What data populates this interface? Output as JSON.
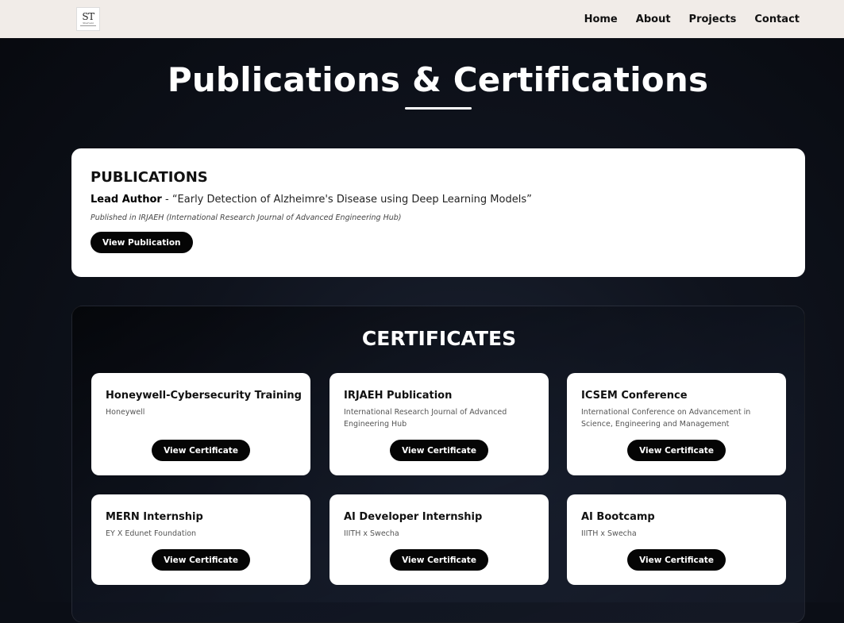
{
  "nav": {
    "logo_text": "ST",
    "logo_sub": "Sharvani",
    "links": [
      "Home",
      "About",
      "Projects",
      "Contact"
    ]
  },
  "page": {
    "title": "Publications & Certifications"
  },
  "publications": {
    "heading": "PUBLICATIONS",
    "role": "Lead Author",
    "separator": " - ",
    "paper_title": "“Early Detection of Alzheimre's Disease using Deep Learning Models”",
    "venue": "Published in IRJAEH (International Research Journal of Advanced Engineering Hub)",
    "button": "View Publication"
  },
  "certificates": {
    "heading": "CERTIFICATES",
    "items": [
      {
        "title": "Honeywell-Cybersecurity Training",
        "issuer": "Honeywell",
        "button": "View Certificate"
      },
      {
        "title": "IRJAEH Publication",
        "issuer": "International Research Journal of Advanced Engineering Hub",
        "button": "View Certificate"
      },
      {
        "title": "ICSEM Conference",
        "issuer": "International Conference on Advancement in Science, Engineering and Management",
        "button": "View Certificate"
      },
      {
        "title": "MERN Internship",
        "issuer": "EY X Edunet Foundation",
        "button": "View Certificate"
      },
      {
        "title": "AI Developer Internship",
        "issuer": "IIITH x Swecha",
        "button": "View Certificate"
      },
      {
        "title": "AI Bootcamp",
        "issuer": "IIITH x Swecha",
        "button": "View Certificate"
      }
    ]
  }
}
